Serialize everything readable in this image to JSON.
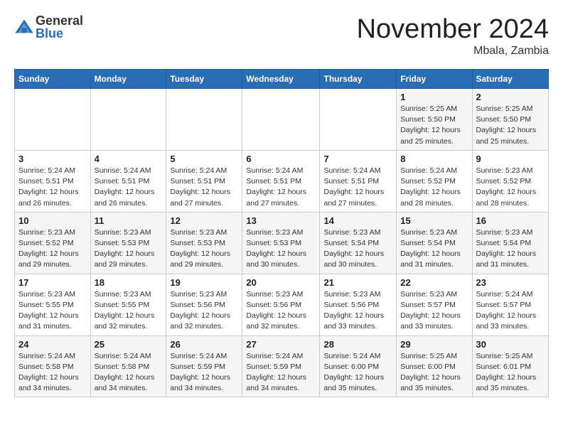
{
  "header": {
    "logo_general": "General",
    "logo_blue": "Blue",
    "month": "November 2024",
    "location": "Mbala, Zambia"
  },
  "days_of_week": [
    "Sunday",
    "Monday",
    "Tuesday",
    "Wednesday",
    "Thursday",
    "Friday",
    "Saturday"
  ],
  "weeks": [
    [
      {
        "day": "",
        "info": ""
      },
      {
        "day": "",
        "info": ""
      },
      {
        "day": "",
        "info": ""
      },
      {
        "day": "",
        "info": ""
      },
      {
        "day": "",
        "info": ""
      },
      {
        "day": "1",
        "info": "Sunrise: 5:25 AM\nSunset: 5:50 PM\nDaylight: 12 hours\nand 25 minutes."
      },
      {
        "day": "2",
        "info": "Sunrise: 5:25 AM\nSunset: 5:50 PM\nDaylight: 12 hours\nand 25 minutes."
      }
    ],
    [
      {
        "day": "3",
        "info": "Sunrise: 5:24 AM\nSunset: 5:51 PM\nDaylight: 12 hours\nand 26 minutes."
      },
      {
        "day": "4",
        "info": "Sunrise: 5:24 AM\nSunset: 5:51 PM\nDaylight: 12 hours\nand 26 minutes."
      },
      {
        "day": "5",
        "info": "Sunrise: 5:24 AM\nSunset: 5:51 PM\nDaylight: 12 hours\nand 27 minutes."
      },
      {
        "day": "6",
        "info": "Sunrise: 5:24 AM\nSunset: 5:51 PM\nDaylight: 12 hours\nand 27 minutes."
      },
      {
        "day": "7",
        "info": "Sunrise: 5:24 AM\nSunset: 5:51 PM\nDaylight: 12 hours\nand 27 minutes."
      },
      {
        "day": "8",
        "info": "Sunrise: 5:24 AM\nSunset: 5:52 PM\nDaylight: 12 hours\nand 28 minutes."
      },
      {
        "day": "9",
        "info": "Sunrise: 5:23 AM\nSunset: 5:52 PM\nDaylight: 12 hours\nand 28 minutes."
      }
    ],
    [
      {
        "day": "10",
        "info": "Sunrise: 5:23 AM\nSunset: 5:52 PM\nDaylight: 12 hours\nand 29 minutes."
      },
      {
        "day": "11",
        "info": "Sunrise: 5:23 AM\nSunset: 5:53 PM\nDaylight: 12 hours\nand 29 minutes."
      },
      {
        "day": "12",
        "info": "Sunrise: 5:23 AM\nSunset: 5:53 PM\nDaylight: 12 hours\nand 29 minutes."
      },
      {
        "day": "13",
        "info": "Sunrise: 5:23 AM\nSunset: 5:53 PM\nDaylight: 12 hours\nand 30 minutes."
      },
      {
        "day": "14",
        "info": "Sunrise: 5:23 AM\nSunset: 5:54 PM\nDaylight: 12 hours\nand 30 minutes."
      },
      {
        "day": "15",
        "info": "Sunrise: 5:23 AM\nSunset: 5:54 PM\nDaylight: 12 hours\nand 31 minutes."
      },
      {
        "day": "16",
        "info": "Sunrise: 5:23 AM\nSunset: 5:54 PM\nDaylight: 12 hours\nand 31 minutes."
      }
    ],
    [
      {
        "day": "17",
        "info": "Sunrise: 5:23 AM\nSunset: 5:55 PM\nDaylight: 12 hours\nand 31 minutes."
      },
      {
        "day": "18",
        "info": "Sunrise: 5:23 AM\nSunset: 5:55 PM\nDaylight: 12 hours\nand 32 minutes."
      },
      {
        "day": "19",
        "info": "Sunrise: 5:23 AM\nSunset: 5:56 PM\nDaylight: 12 hours\nand 32 minutes."
      },
      {
        "day": "20",
        "info": "Sunrise: 5:23 AM\nSunset: 5:56 PM\nDaylight: 12 hours\nand 32 minutes."
      },
      {
        "day": "21",
        "info": "Sunrise: 5:23 AM\nSunset: 5:56 PM\nDaylight: 12 hours\nand 33 minutes."
      },
      {
        "day": "22",
        "info": "Sunrise: 5:23 AM\nSunset: 5:57 PM\nDaylight: 12 hours\nand 33 minutes."
      },
      {
        "day": "23",
        "info": "Sunrise: 5:24 AM\nSunset: 5:57 PM\nDaylight: 12 hours\nand 33 minutes."
      }
    ],
    [
      {
        "day": "24",
        "info": "Sunrise: 5:24 AM\nSunset: 5:58 PM\nDaylight: 12 hours\nand 34 minutes."
      },
      {
        "day": "25",
        "info": "Sunrise: 5:24 AM\nSunset: 5:58 PM\nDaylight: 12 hours\nand 34 minutes."
      },
      {
        "day": "26",
        "info": "Sunrise: 5:24 AM\nSunset: 5:59 PM\nDaylight: 12 hours\nand 34 minutes."
      },
      {
        "day": "27",
        "info": "Sunrise: 5:24 AM\nSunset: 5:59 PM\nDaylight: 12 hours\nand 34 minutes."
      },
      {
        "day": "28",
        "info": "Sunrise: 5:24 AM\nSunset: 6:00 PM\nDaylight: 12 hours\nand 35 minutes."
      },
      {
        "day": "29",
        "info": "Sunrise: 5:25 AM\nSunset: 6:00 PM\nDaylight: 12 hours\nand 35 minutes."
      },
      {
        "day": "30",
        "info": "Sunrise: 5:25 AM\nSunset: 6:01 PM\nDaylight: 12 hours\nand 35 minutes."
      }
    ]
  ]
}
